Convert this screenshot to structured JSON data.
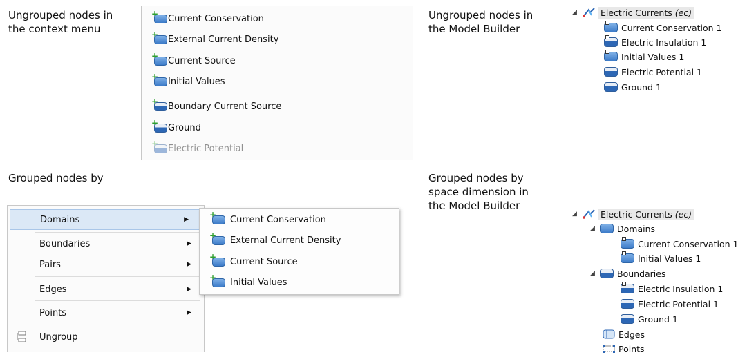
{
  "captions": {
    "top_left": [
      "Ungrouped nodes in",
      "the context menu"
    ],
    "top_right": [
      "Ungrouped nodes in",
      "the Model Builder"
    ],
    "bottom_left": [
      "Grouped nodes by"
    ],
    "bottom_right": [
      "Grouped nodes by",
      "space dimension in",
      "the Model Builder"
    ]
  },
  "context_menu_top": {
    "items": [
      {
        "label": "Current Conservation",
        "icon": "domain-node-icon"
      },
      {
        "label": "External Current Density",
        "icon": "domain-node-icon"
      },
      {
        "label": "Current Source",
        "icon": "domain-node-icon"
      },
      {
        "label": "Initial Values",
        "icon": "domain-node-icon"
      },
      {
        "label": "Boundary Current Source",
        "icon": "boundary-node-icon"
      },
      {
        "label": "Ground",
        "icon": "boundary-node-icon"
      },
      {
        "label": "Electric Potential",
        "icon": "boundary-node-icon"
      }
    ]
  },
  "tree_top": {
    "root": {
      "label": "Electric Currents",
      "tag": "(ec)"
    },
    "children": [
      "Current Conservation 1",
      "Electric Insulation 1",
      "Initial Values 1",
      "Electric Potential 1",
      "Ground 1"
    ]
  },
  "context_menu_bottom": {
    "items": [
      "Domains",
      "Boundaries",
      "Pairs",
      "Edges",
      "Points",
      "Ungroup"
    ],
    "submenu": [
      "Current Conservation",
      "External Current Density",
      "Current Source",
      "Initial Values"
    ]
  },
  "tree_bottom": {
    "root": {
      "label": "Electric Currents",
      "tag": "(ec)"
    },
    "domains": {
      "label": "Domains",
      "children": [
        "Current Conservation 1",
        "Initial Values 1"
      ]
    },
    "boundaries": {
      "label": "Boundaries",
      "children": [
        "Electric Insulation 1",
        "Electric Potential 1",
        "Ground 1"
      ]
    },
    "edges": "Edges",
    "points": "Points"
  },
  "colors": {
    "accent": "#2d67b5",
    "plus": "#2f9f2f",
    "highlight": "#dbe8f6"
  }
}
